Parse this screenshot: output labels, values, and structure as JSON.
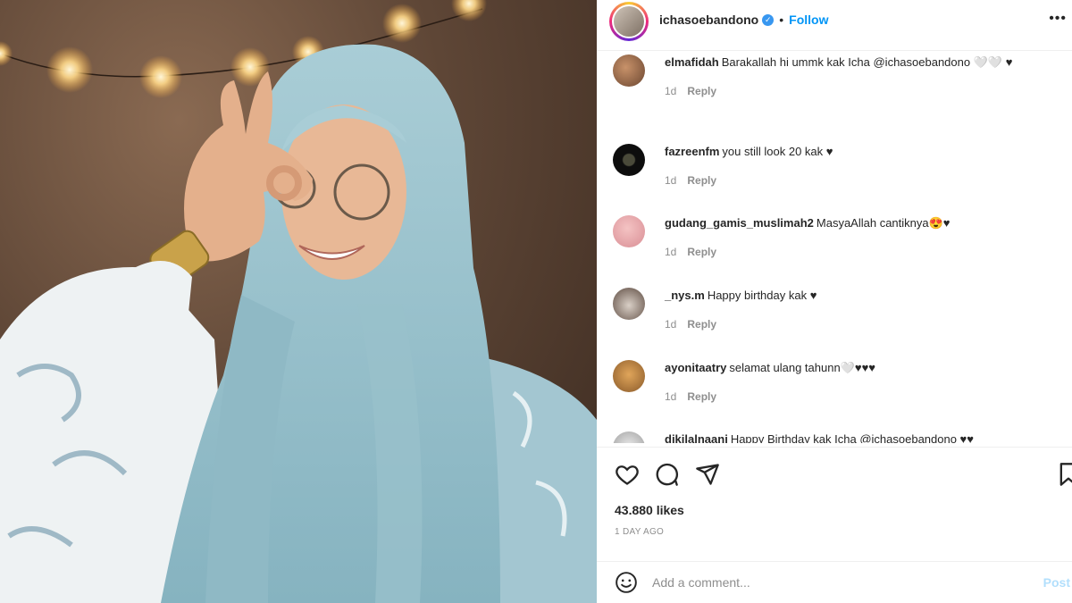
{
  "post": {
    "username": "ichasoebandono",
    "follow_label": "Follow",
    "separator": "•",
    "more_label": "•••",
    "verified_glyph": "✓"
  },
  "comments": [
    {
      "user": "elmafidah",
      "text": "Barakallah hi ummk kak Icha @ichasoebandono 🤍🤍 ♥",
      "time": "1d",
      "reply": "Reply"
    },
    {
      "user": "fazreenfm",
      "text": "you still look 20 kak ♥",
      "time": "1d",
      "reply": "Reply"
    },
    {
      "user": "gudang_gamis_muslimah2",
      "text": "MasyaAllah cantiknya😍♥",
      "time": "1d",
      "reply": "Reply"
    },
    {
      "user": "_nys.m",
      "text": "Happy birthday kak ♥",
      "time": "1d",
      "reply": "Reply"
    },
    {
      "user": "ayonitaatry",
      "text": "selamat ulang tahunn🤍♥♥♥",
      "time": "1d",
      "reply": "Reply"
    },
    {
      "user": "dikilalnaani",
      "text": "Happy Birthday kak Icha @ichasoebandono ♥♥",
      "time": "",
      "reply": ""
    }
  ],
  "likes": "43.880 likes",
  "date": "1 DAY AGO",
  "comment_input": {
    "placeholder": "Add a comment...",
    "post_label": "Post"
  },
  "icons": {
    "like": "heart-icon",
    "comment": "comment-icon",
    "share": "send-icon",
    "save": "bookmark-icon",
    "emoji": "emoji-icon",
    "more": "more-icon"
  },
  "colors": {
    "follow": "#0095f6",
    "verified": "#3897f0",
    "muted": "#8e8e8e",
    "post_disabled": "#b2dffc"
  }
}
